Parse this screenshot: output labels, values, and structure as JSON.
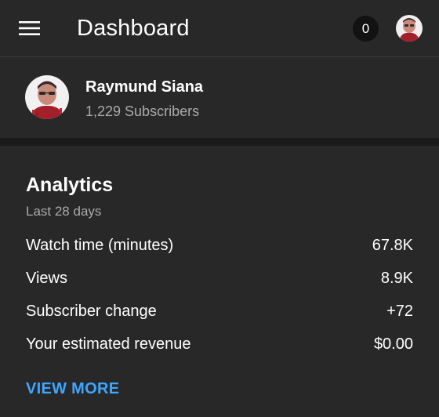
{
  "header": {
    "title": "Dashboard",
    "notification_count": "0",
    "menu_icon": "hamburger-menu-icon",
    "account_icon": "account-avatar"
  },
  "channel": {
    "name": "Raymund Siana",
    "subscribers": "1,229 Subscribers"
  },
  "analytics": {
    "title": "Analytics",
    "period": "Last 28 days",
    "metrics": [
      {
        "label": "Watch time (minutes)",
        "value": "67.8K"
      },
      {
        "label": "Views",
        "value": "8.9K"
      },
      {
        "label": "Subscriber change",
        "value": "+72"
      },
      {
        "label": "Your estimated revenue",
        "value": "$0.00"
      }
    ],
    "view_more": "VIEW MORE"
  },
  "colors": {
    "background": "#282828",
    "separator": "#1b1b1b",
    "secondary_text": "#aaaaaa",
    "link": "#3ea6ff"
  }
}
